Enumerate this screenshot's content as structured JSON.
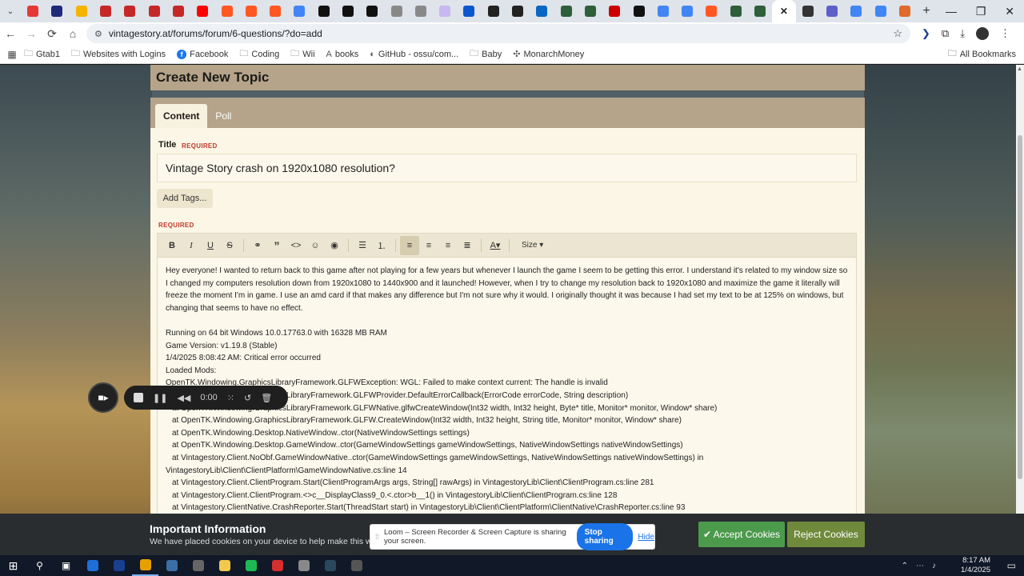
{
  "browser": {
    "tab_colors": [
      "#e53935",
      "#1e2a78",
      "#f4b400",
      "#c62828",
      "#c62828",
      "#c62828",
      "#c62828",
      "#ff0000",
      "#ff5722",
      "#ff5722",
      "#ff5722",
      "#4285f4",
      "#111111",
      "#111111",
      "#111111",
      "#888888",
      "#888888",
      "#c7b9f0",
      "#0b57d0",
      "#222222",
      "#222222",
      "#0a66c2",
      "#2e5e3a",
      "#2e5e3a",
      "#cc0000",
      "#111111",
      "#4285f4",
      "#4285f4",
      "#ff5722",
      "#2e5e3a",
      "#2e5e3a",
      "#333333",
      "#5b5fc7",
      "#4285f4",
      "#4285f4",
      "#e06b2a"
    ],
    "active_tab_close": "✕",
    "new_tab": "+",
    "window_controls": {
      "minimize": "—",
      "restore": "❐",
      "close": "✕"
    },
    "url": "vintagestory.at/forums/forum/6-questions/?do=add",
    "bookmarks": [
      {
        "label": "Gtab1",
        "icon": "folder-icon"
      },
      {
        "label": "Websites with Logins",
        "icon": "folder-icon"
      },
      {
        "label": "Facebook",
        "icon": "facebook-icon"
      },
      {
        "label": "Coding",
        "icon": "folder-icon"
      },
      {
        "label": "Wii",
        "icon": "folder-icon"
      },
      {
        "label": "books",
        "icon": "book-icon"
      },
      {
        "label": "GitHub - ossu/com...",
        "icon": "github-icon"
      },
      {
        "label": "Baby",
        "icon": "folder-icon"
      },
      {
        "label": "MonarchMoney",
        "icon": "monarch-icon"
      }
    ],
    "all_bookmarks": "All Bookmarks"
  },
  "page": {
    "title": "Create New Topic",
    "tabs": [
      {
        "label": "Content",
        "active": true
      },
      {
        "label": "Poll",
        "active": false
      }
    ],
    "title_label": "Title",
    "required": "REQUIRED",
    "title_value": "Vintage Story crash on 1920x1080 resolution?",
    "add_tags": "Add Tags...",
    "editor": {
      "size_label": "Size",
      "paragraph": "Hey everyone! I wanted to return back to this game after not playing for a few years but whenever I launch the game I seem to be getting this error.  I understand it's related to my window size so I changed my computers resolution down from 1920x1080 to 1440x900 and it launched! However, when I try to change my resolution back to 1920x1080 and maximize the game it literally will freeze the moment I'm in game. I use an amd card if that makes any difference but I'm not sure why it would. I originally thought it was because I had set my text to be at 125% on windows, but changing that seems to have no effect.",
      "log": [
        {
          "text": "Running on 64 bit Windows 10.0.17763.0 with 16328 MB RAM",
          "indent": false
        },
        {
          "text": "Game Version: v1.19.8 (Stable)",
          "indent": false
        },
        {
          "text": "1/4/2025 8:08:42 AM: Critical error occurred",
          "indent": false
        },
        {
          "text": "Loaded Mods:",
          "indent": false
        },
        {
          "text": "OpenTK.Windowing.GraphicsLibraryFramework.GLFWException: WGL: Failed to make context current: The handle is invalid",
          "indent": false
        },
        {
          "text": "at OpenTK.Windowing.GraphicsLibraryFramework.GLFWProvider.DefaultErrorCallback(ErrorCode errorCode, String description)",
          "indent": true
        },
        {
          "text": "at OpenTK.Windowing.GraphicsLibraryFramework.GLFWNative.glfwCreateWindow(Int32 width, Int32 height, Byte* title, Monitor* monitor, Window* share)",
          "indent": true
        },
        {
          "text": "at OpenTK.Windowing.GraphicsLibraryFramework.GLFW.CreateWindow(Int32 width, Int32 height, String title, Monitor* monitor, Window* share)",
          "indent": true
        },
        {
          "text": "at OpenTK.Windowing.Desktop.NativeWindow..ctor(NativeWindowSettings settings)",
          "indent": true
        },
        {
          "text": "at OpenTK.Windowing.Desktop.GameWindow..ctor(GameWindowSettings gameWindowSettings, NativeWindowSettings nativeWindowSettings)",
          "indent": true
        },
        {
          "text": "at Vintagestory.Client.NoObf.GameWindowNative..ctor(GameWindowSettings gameWindowSettings, NativeWindowSettings nativeWindowSettings) in",
          "indent": true
        },
        {
          "text": "VintagestoryLib\\Client\\ClientPlatform\\GameWindowNative.cs:line 14",
          "indent": false
        },
        {
          "text": "at Vintagestory.Client.ClientProgram.Start(ClientProgramArgs args, String[] rawArgs) in VintagestoryLib\\Client\\ClientProgram.cs:line 281",
          "indent": true
        },
        {
          "text": "at Vintagestory.Client.ClientProgram.<>c__DisplayClass9_0.<.ctor>b__1() in VintagestoryLib\\Client\\ClientProgram.cs:line 128",
          "indent": true
        },
        {
          "text": "at Vintagestory.ClientNative.CrashReporter.Start(ThreadStart start) in VintagestoryLib\\Client\\ClientPlatform\\ClientNative\\CrashReporter.cs:line 93",
          "indent": true
        }
      ]
    }
  },
  "loom": {
    "time": "0:00",
    "share_message": "Loom – Screen Recorder & Screen Capture is sharing your screen.",
    "stop_sharing": "Stop sharing",
    "hide": "Hide"
  },
  "cookie": {
    "title": "Important Information",
    "text": "We have placed cookies on your device to help make this website better",
    "accept": "Accept Cookies",
    "reject": "Reject Cookies"
  },
  "taskbar": {
    "app_colors": [
      "#1e6fd9",
      "#1a3f8f",
      "#e8a000",
      "#3a6ea5",
      "#666666",
      "#f2c94c",
      "#1db954",
      "#d32f2f",
      "#888888",
      "#2a475e",
      "#555555"
    ],
    "time": "8:17 AM",
    "date": "1/4/2025"
  }
}
